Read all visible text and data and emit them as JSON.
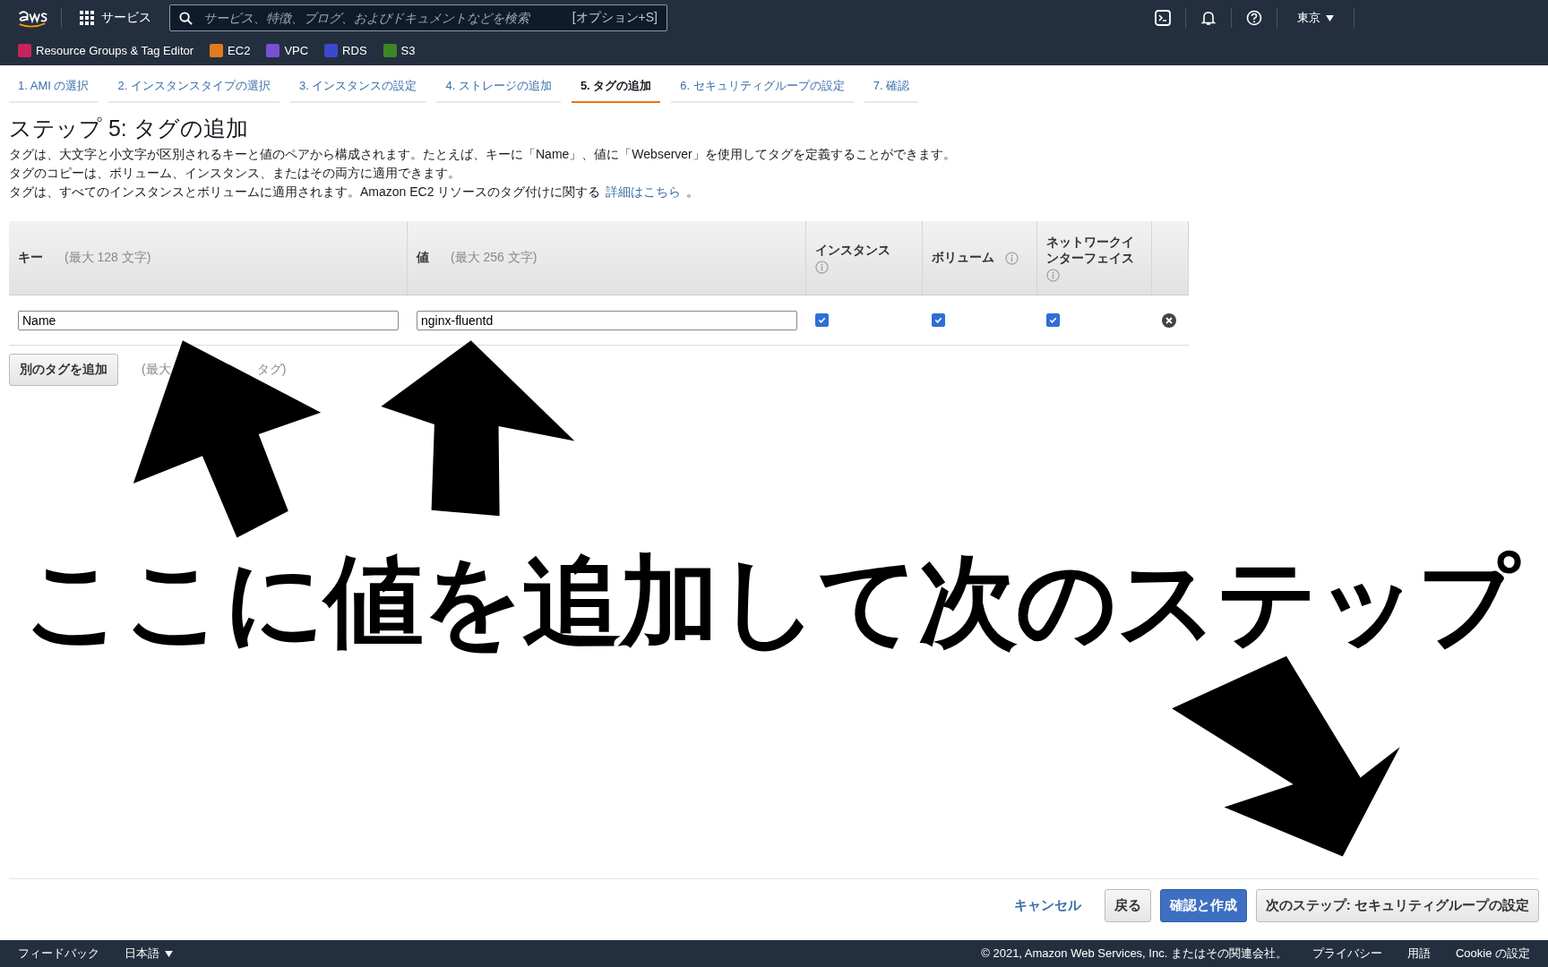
{
  "top_nav": {
    "services_label": "サービス",
    "search": {
      "placeholder": "サービス、特徴、ブログ、およびドキュメントなどを検索",
      "shortcut": "[オプション+S]"
    },
    "region": "東京"
  },
  "favorites": [
    {
      "label": "Resource Groups & Tag Editor",
      "color": "#c7235d"
    },
    {
      "label": "EC2",
      "color": "#e07b1f"
    },
    {
      "label": "VPC",
      "color": "#7b4fd1"
    },
    {
      "label": "RDS",
      "color": "#3b48cc"
    },
    {
      "label": "S3",
      "color": "#3f8624"
    }
  ],
  "steps": [
    {
      "label": "1. AMI の選択",
      "selected": false
    },
    {
      "label": "2. インスタンスタイプの選択",
      "selected": false
    },
    {
      "label": "3. インスタンスの設定",
      "selected": false
    },
    {
      "label": "4. ストレージの追加",
      "selected": false
    },
    {
      "label": "5. タグの追加",
      "selected": true
    },
    {
      "label": "6. セキュリティグループの設定",
      "selected": false
    },
    {
      "label": "7. 確認",
      "selected": false
    }
  ],
  "heading": "ステップ 5: タグの追加",
  "intro_lines": [
    "タグは、大文字と小文字が区別されるキーと値のペアから構成されます。たとえば、キーに「Name」、値に「Webserver」を使用してタグを定義することができます。",
    "タグのコピーは、ボリューム、インスタンス、またはその両方に適用できます。"
  ],
  "link_line": {
    "text": "タグは、すべてのインスタンスとボリュームに適用されます。Amazon EC2 リソースのタグ付けに関する",
    "link": "詳細はこちら",
    "suffix": "。"
  },
  "table": {
    "columns": [
      {
        "label": "キー",
        "hint": "(最大 128 文字)",
        "info": false
      },
      {
        "label": "値",
        "hint": "(最大 256 文字)",
        "info": false
      },
      {
        "label": "インスタンス",
        "info": true
      },
      {
        "label": "ボリューム",
        "info": true
      },
      {
        "label": "ネットワークインターフェイス",
        "info": true
      }
    ],
    "rows": [
      {
        "key": "Name",
        "value": "nginx-fluentd",
        "instances": true,
        "volumes": true,
        "network_interfaces": true
      }
    ]
  },
  "add_button": "別のタグを追加",
  "limit_hint_parts": [
    "(最大",
    "タグ)"
  ],
  "annotation": {
    "text": "ここに値を追加して次のステップ"
  },
  "actions": [
    {
      "label": "キャンセル",
      "kind": "link"
    },
    {
      "label": "戻る",
      "kind": "secondary"
    },
    {
      "label": "確認と作成",
      "kind": "primary"
    },
    {
      "label": "次のステップ: セキュリティグループの設定",
      "kind": "secondary"
    }
  ],
  "footer": {
    "feedback": "フィードバック",
    "language": "日本語",
    "copyright": "© 2021, Amazon Web Services, Inc. またはその関連会社。",
    "links": [
      "プライバシー",
      "用語",
      "Cookie の設定"
    ]
  }
}
